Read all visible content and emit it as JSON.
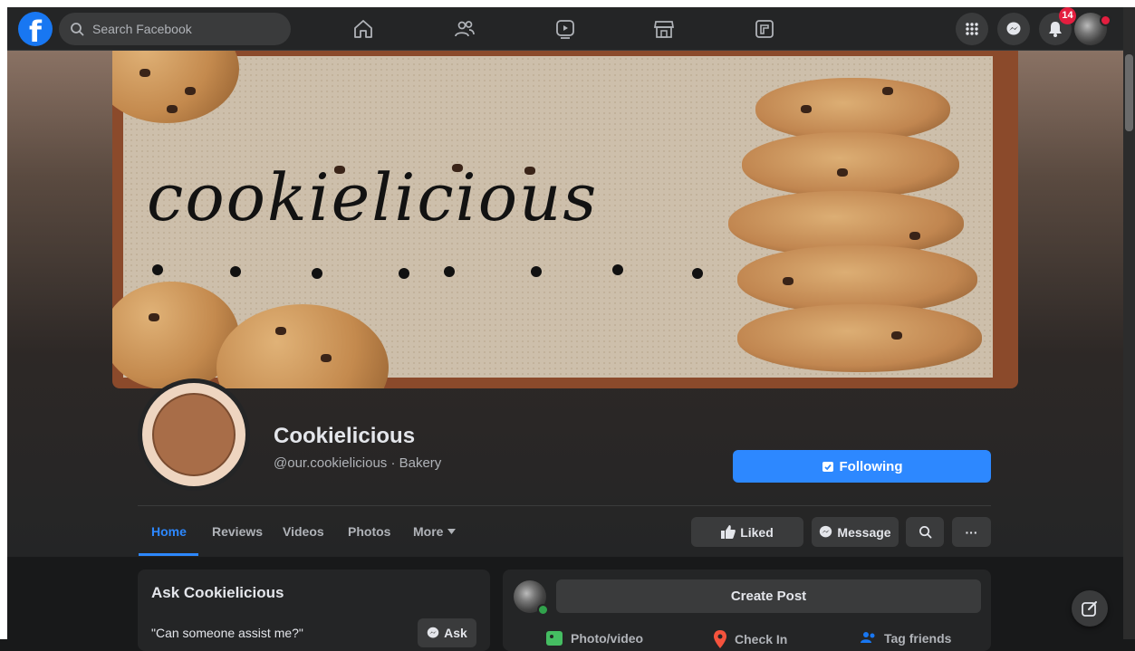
{
  "nav": {
    "search_placeholder": "Search Facebook",
    "notification_count": "14",
    "logo_letter": "f"
  },
  "cover": {
    "script_text": "cookielicious"
  },
  "profile": {
    "name": "Cookielicious",
    "subtitle": "@our.cookielicious · Bakery",
    "following_label": "Following"
  },
  "tabs": [
    {
      "label": "Home",
      "active": true
    },
    {
      "label": "Reviews"
    },
    {
      "label": "Videos"
    },
    {
      "label": "Photos"
    },
    {
      "label": "More"
    }
  ],
  "actions": {
    "liked": "Liked",
    "message": "Message",
    "more": "···"
  },
  "ask": {
    "title": "Ask Cookielicious",
    "question": "\"Can someone assist me?\"",
    "button": "Ask"
  },
  "create_post": {
    "label": "Create Post",
    "options": [
      "Photo/video",
      "Check In",
      "Tag friends"
    ]
  },
  "colors": {
    "accent": "#2d88ff",
    "background": "#18191a",
    "surface": "#242526",
    "badge": "#e41e3f"
  }
}
